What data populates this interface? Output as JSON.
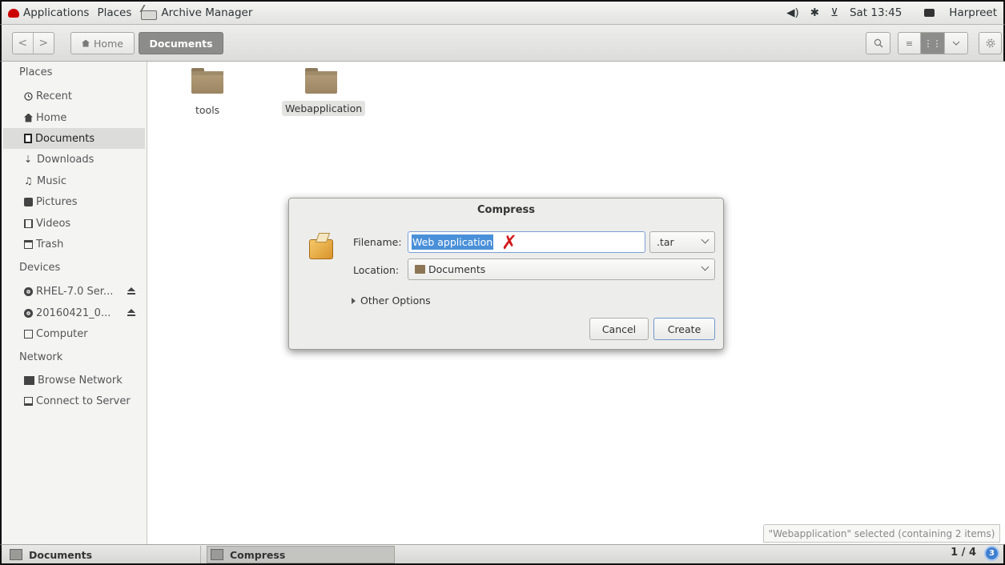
{
  "topbar": {
    "applications": "Applications",
    "places": "Places",
    "app_name": "Archive Manager",
    "clock": "Sat 13:45",
    "user": "Harpreet"
  },
  "toolbar": {
    "back_glyph": "<",
    "forward_glyph": ">",
    "breadcrumb_home": "Home",
    "breadcrumb_current": "Documents"
  },
  "sidebar": {
    "places_heading": "Places",
    "places": [
      "Recent",
      "Home",
      "Documents",
      "Downloads",
      "Music",
      "Pictures",
      "Videos",
      "Trash"
    ],
    "active": "Documents",
    "devices_heading": "Devices",
    "devices": [
      "RHEL-7.0 Ser...",
      "20160421_0...",
      "Computer"
    ],
    "network_heading": "Network",
    "network": [
      "Browse Network",
      "Connect to Server"
    ]
  },
  "files": [
    {
      "name": "tools",
      "selected": false
    },
    {
      "name": "Webapplication",
      "selected": true
    }
  ],
  "dialog": {
    "title": "Compress",
    "filename_label": "Filename:",
    "filename_value": "Web application",
    "extension": ".tar",
    "location_label": "Location:",
    "location_value": "Documents",
    "other_options": "Other Options",
    "cancel": "Cancel",
    "create": "Create",
    "annotation_mark": "✗"
  },
  "status": "\"Webapplication\" selected (containing 2 items)",
  "taskbar": {
    "task1": "Documents",
    "task2": "Compress",
    "workspace": "1 / 4",
    "notifications": "3"
  },
  "colors": {
    "selection": "#4a90d9",
    "annotation_red": "#d21b1b",
    "folder": "#a08b69"
  }
}
